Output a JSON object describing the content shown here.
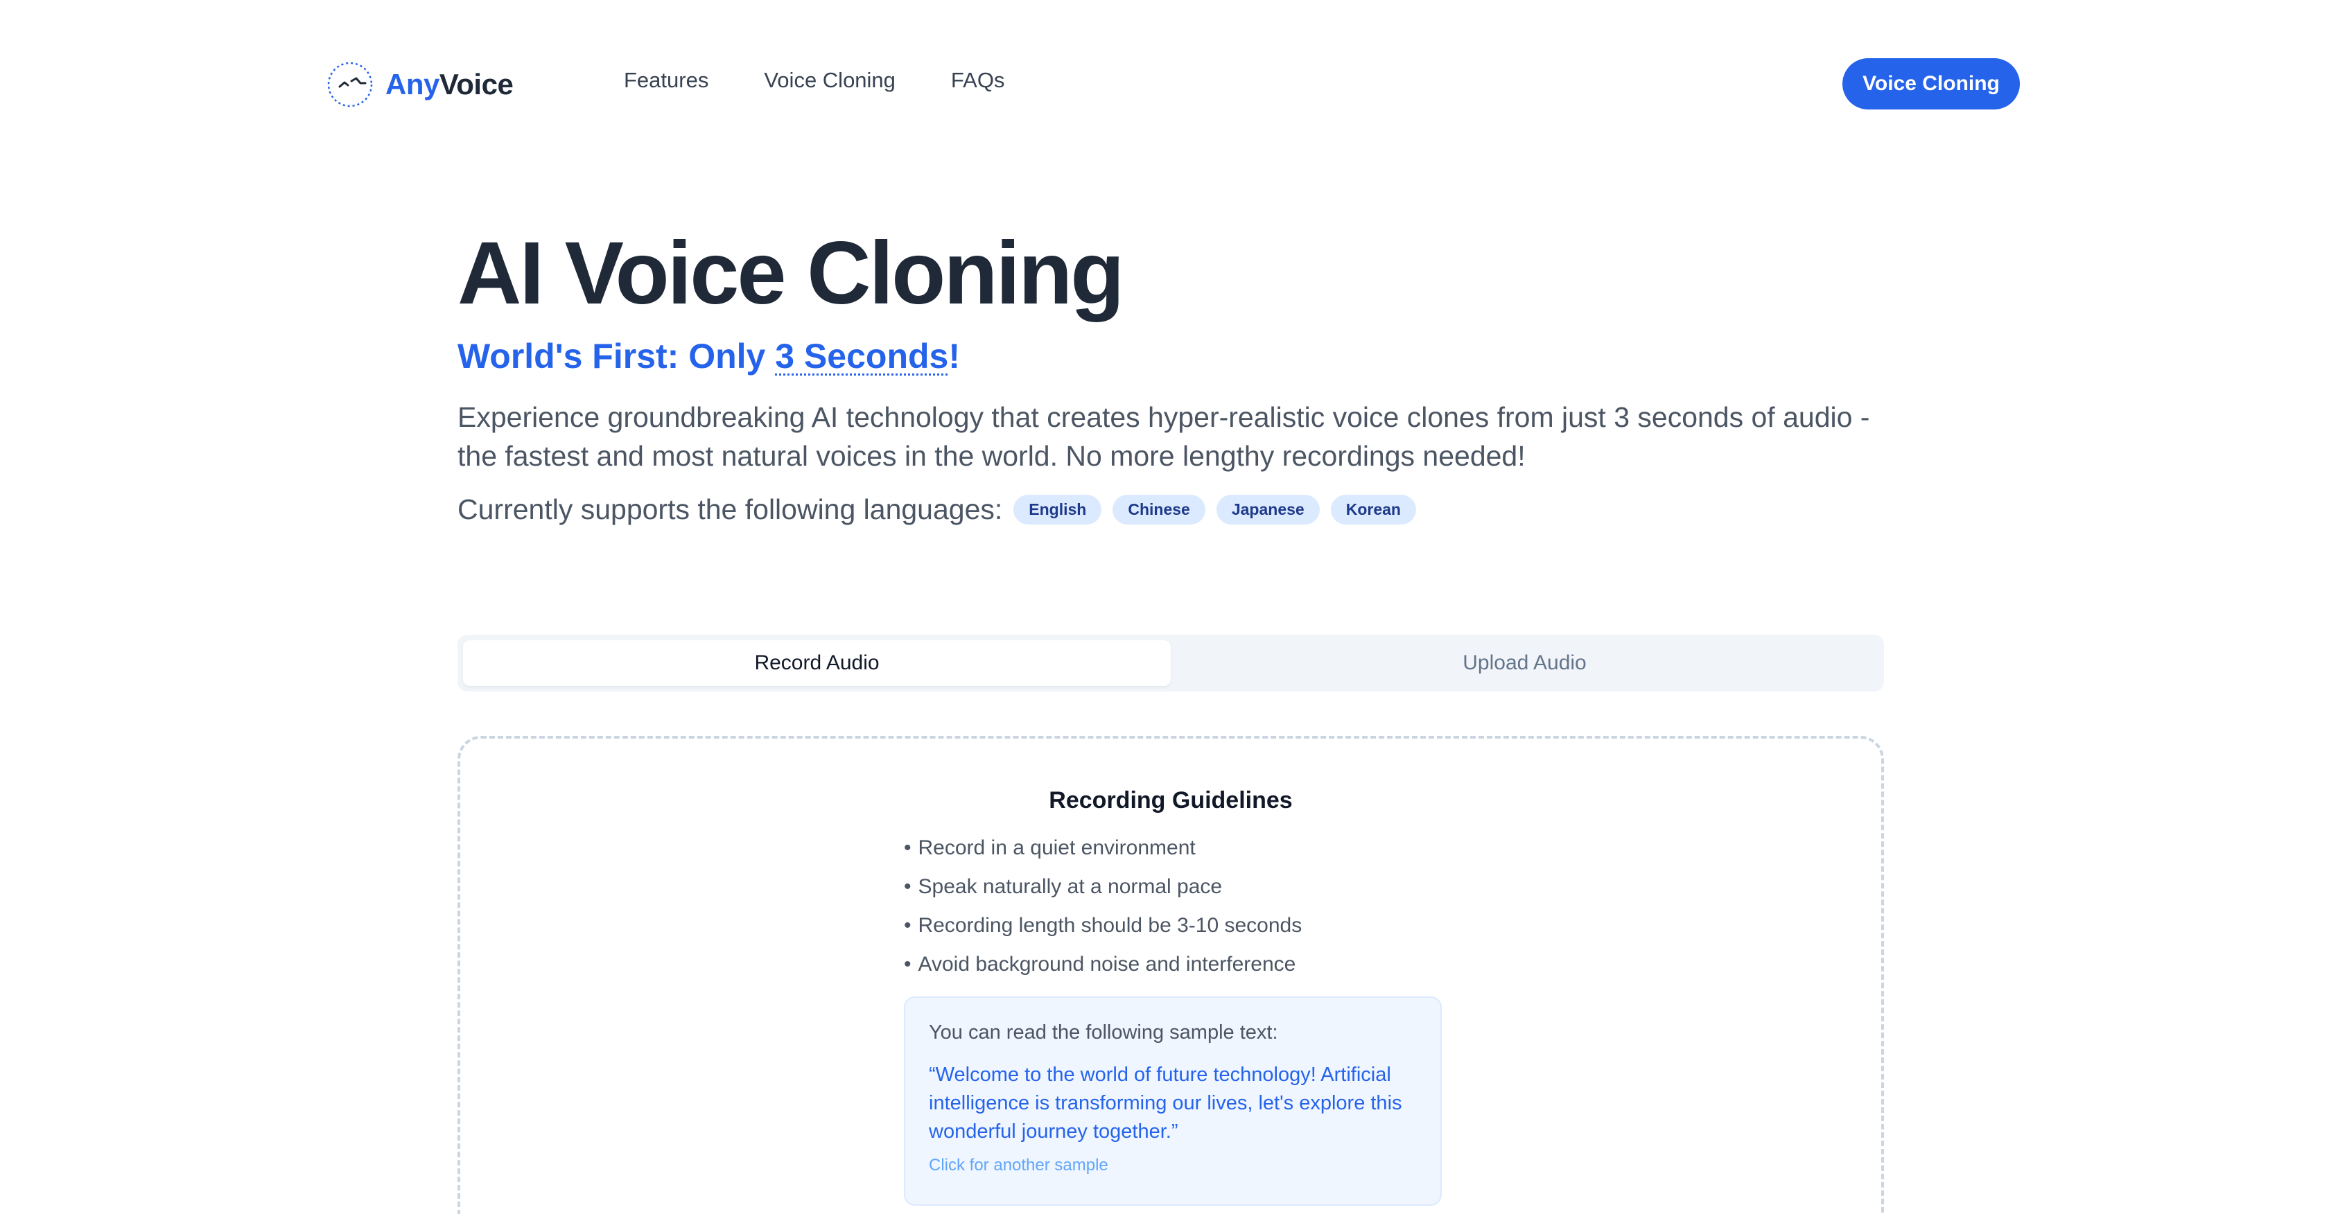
{
  "header": {
    "logo_part1": "Any",
    "logo_part2": "Voice",
    "nav": [
      {
        "label": "Features"
      },
      {
        "label": "Voice Cloning"
      },
      {
        "label": "FAQs"
      }
    ],
    "cta_label": "Voice Cloning"
  },
  "hero": {
    "title": "AI Voice Cloning",
    "subtitle_prefix": "World's First: Only ",
    "subtitle_highlight": "3 Seconds",
    "subtitle_suffix": "!",
    "description": "Experience groundbreaking AI technology that creates hyper-realistic voice clones from just 3 seconds of audio - the fastest and most natural voices in the world. No more lengthy recordings needed!",
    "languages_label": "Currently supports the following languages:",
    "languages": [
      "English",
      "Chinese",
      "Japanese",
      "Korean"
    ]
  },
  "tabs": [
    {
      "label": "Record Audio",
      "active": true
    },
    {
      "label": "Upload Audio",
      "active": false
    }
  ],
  "recorder": {
    "guidelines_title": "Recording Guidelines",
    "guidelines": [
      "Record in a quiet environment",
      "Speak naturally at a normal pace",
      "Recording length should be 3-10 seconds",
      "Avoid background noise and interference"
    ],
    "sample_label": "You can read the following sample text:",
    "sample_text": "“Welcome to the world of future technology! Artificial intelligence is transforming our lives, let's explore this wonderful journey together.”",
    "sample_link": "Click for another sample"
  },
  "colors": {
    "accent": "#2563eb",
    "text_dark": "#1f2937",
    "tag_bg": "#dbeafe",
    "sample_bg": "#eff6ff"
  },
  "icons": {
    "logo": "clock-wave-icon"
  }
}
